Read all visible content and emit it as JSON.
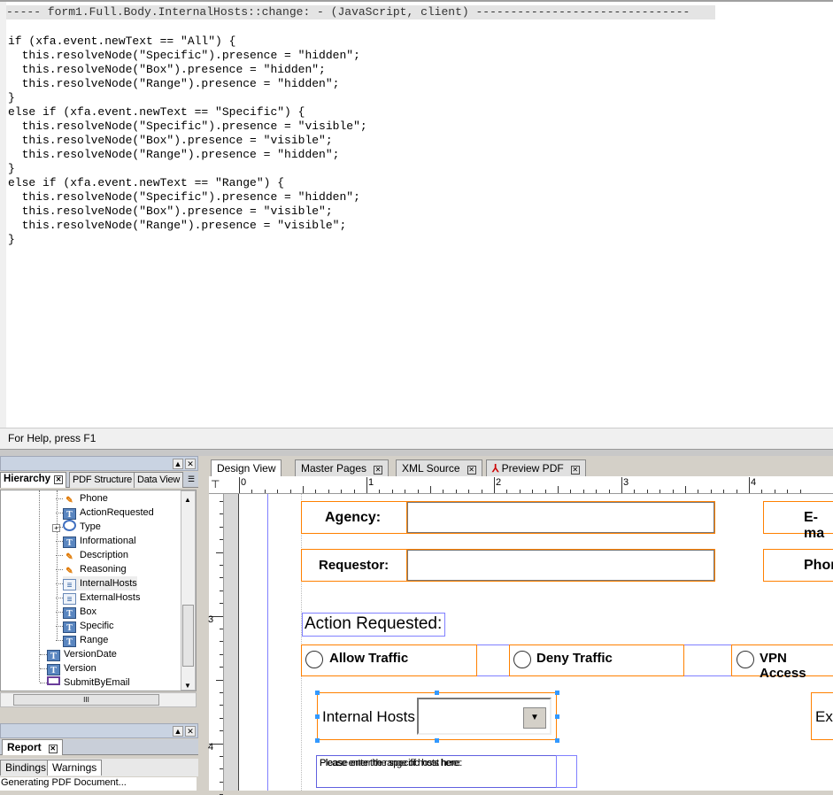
{
  "editor": {
    "header": "----- form1.Full.Body.InternalHosts::change: - (JavaScript, client) -------------------------------",
    "code_lines": [
      "if (xfa.event.newText == \"All\") {",
      "  this.resolveNode(\"Specific\").presence = \"hidden\";",
      "  this.resolveNode(\"Box\").presence = \"hidden\";",
      "  this.resolveNode(\"Range\").presence = \"hidden\";",
      "}",
      "else if (xfa.event.newText == \"Specific\") {",
      "  this.resolveNode(\"Specific\").presence = \"visible\";",
      "  this.resolveNode(\"Box\").presence = \"visible\";",
      "  this.resolveNode(\"Range\").presence = \"hidden\";",
      "}",
      "else if (xfa.event.newText == \"Range\") {",
      "  this.resolveNode(\"Specific\").presence = \"hidden\";",
      "  this.resolveNode(\"Box\").presence = \"visible\";",
      "  this.resolveNode(\"Range\").presence = \"visible\";",
      "}"
    ]
  },
  "status_bar": "For Help, press F1",
  "hierarchy_panel": {
    "tabs": [
      "Hierarchy",
      "PDF Structure",
      "Data View"
    ],
    "tab_visible_text": [
      "Hierarchy",
      "DF Structure",
      "ata View"
    ],
    "items": [
      {
        "label": "Phone",
        "icon": "pencil-icon"
      },
      {
        "label": "ActionRequested",
        "icon": "text-icon"
      },
      {
        "label": "Type",
        "icon": "radio-group-icon"
      },
      {
        "label": "Informational",
        "icon": "text-icon"
      },
      {
        "label": "Description",
        "icon": "pencil-icon"
      },
      {
        "label": "Reasoning",
        "icon": "pencil-icon"
      },
      {
        "label": "InternalHosts",
        "icon": "dropdown-list-icon"
      },
      {
        "label": "ExternalHosts",
        "icon": "dropdown-list-icon"
      },
      {
        "label": "Box",
        "icon": "text-icon"
      },
      {
        "label": "Specific",
        "icon": "text-icon"
      },
      {
        "label": "Range",
        "icon": "text-icon"
      },
      {
        "label": "VersionDate",
        "icon": "text-icon"
      },
      {
        "label": "Version",
        "icon": "text-icon"
      },
      {
        "label": "SubmitByEmail",
        "icon": "button-icon"
      }
    ],
    "hscroll_grip": "III"
  },
  "report_panel": {
    "title": "Report",
    "tabs": [
      "Bindings",
      "Warnings"
    ],
    "message": "Generating PDF Document..."
  },
  "design": {
    "tabs": [
      "Design View",
      "Master Pages",
      "XML Source",
      "Preview PDF"
    ],
    "ruler_h": [
      "0",
      "1",
      "2",
      "3",
      "4"
    ],
    "ruler_v": [
      "3",
      "4"
    ],
    "form": {
      "agency_label": "Agency:",
      "email_label": "E-ma",
      "requestor_label": "Requestor:",
      "phone_label": "Phon",
      "action_requested": "Action Requested:",
      "options": [
        "Allow Traffic",
        "Deny Traffic",
        "VPN Access"
      ],
      "internal_hosts_label": "Internal Hosts",
      "external_label": "Ext",
      "specific_prompt": "Please enter the specific host here:",
      "range_prompt": "Please enter the range of hosts here:"
    }
  },
  "colors": {
    "field_border": "#ff8000",
    "selection": "#8080ff",
    "handle": "#3399ff"
  }
}
